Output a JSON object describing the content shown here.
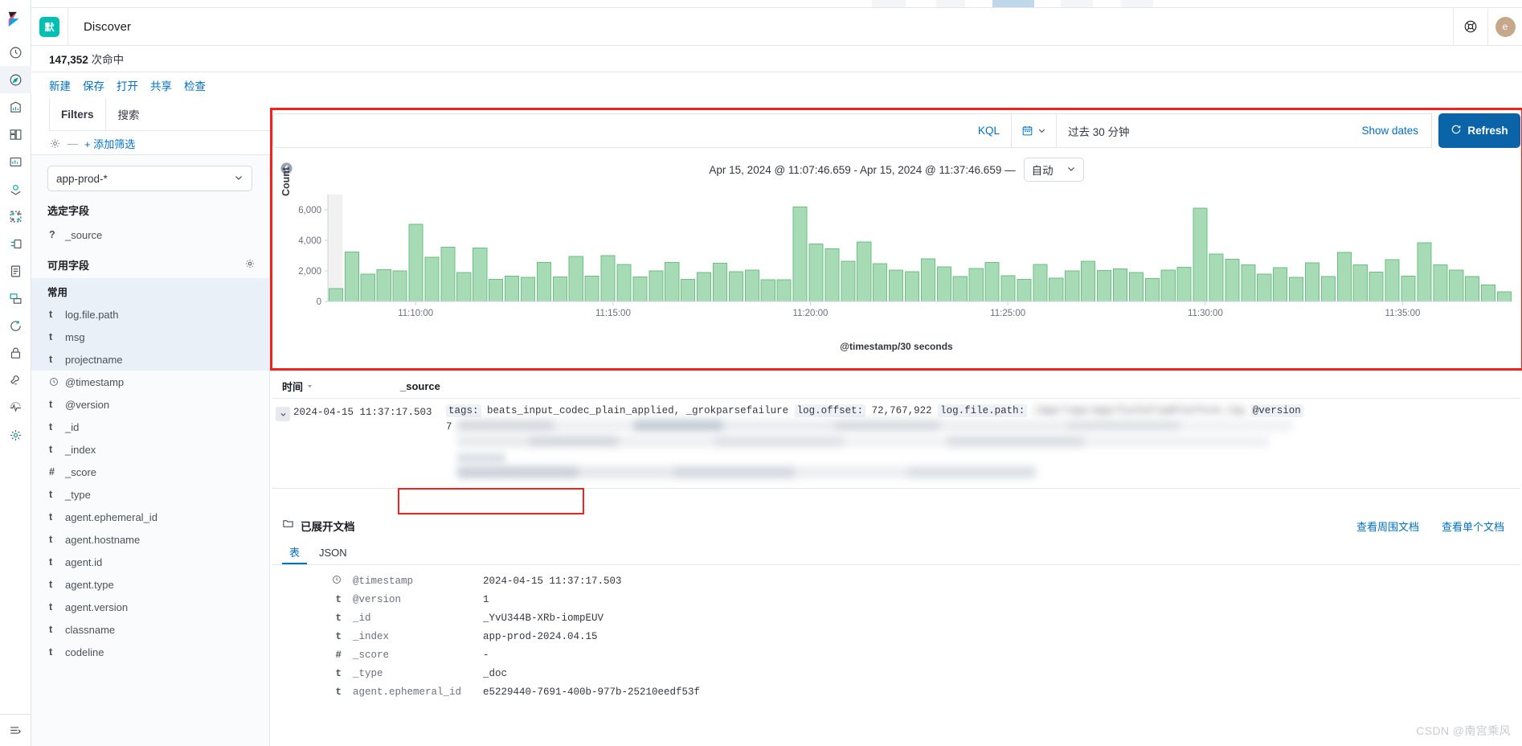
{
  "header": {
    "space_badge": "默",
    "app_title": "Discover",
    "help_icon": "help-circle-icon",
    "avatar_initial": "e"
  },
  "hits": {
    "count": "147,352",
    "suffix": "次命中"
  },
  "menu": {
    "items": [
      "新建",
      "保存",
      "打开",
      "共享",
      "检查"
    ]
  },
  "filterbar": {
    "tabs": [
      "Filters",
      "搜索"
    ],
    "gear_icon": "gear-icon",
    "dash": "—",
    "add_filter": "+ 添加筛选"
  },
  "querybar": {
    "language": "KQL",
    "calendar_icon": "calendar-icon",
    "time_range": "过去 30 分钟",
    "show_dates": "Show dates",
    "refresh_label": "Refresh",
    "refresh_icon": "refresh-icon",
    "refresh_color": "#0b64a8",
    "highlight_color": "#f0241e"
  },
  "sidebar": {
    "index_pattern": "app-prod-*",
    "selected_fields_title": "选定字段",
    "selected_fields": [
      {
        "type": "?",
        "name": "_source"
      }
    ],
    "available_fields_title": "可用字段",
    "gear_icon": "gear-icon",
    "popular_title": "常用",
    "popular_fields": [
      {
        "type": "t",
        "name": "log.file.path"
      },
      {
        "type": "t",
        "name": "msg"
      },
      {
        "type": "t",
        "name": "projectname"
      }
    ],
    "fields": [
      {
        "type": "clock",
        "name": "@timestamp"
      },
      {
        "type": "t",
        "name": "@version"
      },
      {
        "type": "t",
        "name": "_id"
      },
      {
        "type": "t",
        "name": "_index"
      },
      {
        "type": "#",
        "name": "_score"
      },
      {
        "type": "t",
        "name": "_type"
      },
      {
        "type": "t",
        "name": "agent.ephemeral_id"
      },
      {
        "type": "t",
        "name": "agent.hostname"
      },
      {
        "type": "t",
        "name": "agent.id"
      },
      {
        "type": "t",
        "name": "agent.type"
      },
      {
        "type": "t",
        "name": "agent.version"
      },
      {
        "type": "t",
        "name": "classname"
      },
      {
        "type": "t",
        "name": "codeline"
      }
    ]
  },
  "rail": {
    "items": [
      "recently-viewed-icon",
      "discover-icon",
      "visualize-icon",
      "dashboard-icon",
      "canvas-icon",
      "maps-icon",
      "machine-learning-icon",
      "graph-icon",
      "logs-icon",
      "metrics-icon",
      "uptime-icon",
      "security-icon",
      "dev-tools-icon",
      "monitoring-icon",
      "management-icon"
    ],
    "collapse_icon": "collapse-menu-icon"
  },
  "chart": {
    "collapse_icon": "chevron-left-circle-icon",
    "time_range_title": "Apr 15, 2024 @ 11:07:46.659 - Apr 15, 2024 @ 11:37:46.659 —",
    "interval_label": "自动",
    "chevron_icon": "chevron-down-icon"
  },
  "chart_data": {
    "type": "bar",
    "title": "Apr 15, 2024 @ 11:07:46.659 - Apr 15, 2024 @ 11:37:46.659 —",
    "xlabel": "@timestamp/30 seconds",
    "ylabel": "Count",
    "ylim": [
      0,
      7000
    ],
    "yticks": [
      0,
      2000,
      4000,
      6000
    ],
    "ytick_labels": [
      "0",
      "2,000",
      "4,000",
      "6,000"
    ],
    "xtick_labels": [
      "11:10:00",
      "11:15:00",
      "11:20:00",
      "11:25:00",
      "11:30:00",
      "11:35:00"
    ],
    "grid": false,
    "legend": false,
    "bar_color": "#a7dbb5",
    "bar_stroke": "#6cbf84",
    "partial_bucket_color": "#e6e6e6",
    "values": [
      830,
      3250,
      1780,
      2080,
      1990,
      5050,
      2890,
      3560,
      1890,
      3490,
      1440,
      1660,
      1580,
      2540,
      1600,
      2950,
      1650,
      2990,
      2430,
      1610,
      2010,
      2540,
      1460,
      1890,
      2490,
      1940,
      2060,
      1420,
      1430,
      6180,
      3770,
      3450,
      2630,
      3890,
      2470,
      2060,
      1950,
      2780,
      2270,
      1620,
      2160,
      2540,
      1690,
      1450,
      2430,
      1520,
      2000,
      2630,
      2020,
      2130,
      1890,
      1500,
      2050,
      2240,
      6100,
      3100,
      2760,
      2390,
      1790,
      2200,
      1580,
      2520,
      1620,
      3200,
      2390,
      1910,
      2740,
      1650,
      3840,
      2390,
      2050,
      1640,
      1080,
      620
    ]
  },
  "doc_table": {
    "columns": [
      "时间",
      "_source"
    ],
    "sort_icon": "sort-down-icon",
    "row": {
      "time": "2024-04-15 11:37:17.503",
      "expand_icon": "chevron-down-icon",
      "source_parts": [
        {
          "key": "tags:",
          "value": "beats_input_codec_plain_applied, _grokparsefailure"
        },
        {
          "key": "log.offset:",
          "value": "72,767,922"
        },
        {
          "key": "log.file.path:",
          "value": "/app/logs/app/fuifuFlowPlatform.log"
        },
        {
          "key": "@version",
          "value": ""
        }
      ]
    }
  },
  "expanded_doc": {
    "folder_icon": "folder-open-icon",
    "title": "已展开文档",
    "links": [
      "查看周围文档",
      "查看单个文档"
    ],
    "tabs": [
      "表",
      "JSON"
    ],
    "active_tab": "表",
    "fields": [
      {
        "type": "clock",
        "name": "@timestamp",
        "value": "2024-04-15 11:37:17.503",
        "highlight": true
      },
      {
        "type": "t",
        "name": "@version",
        "value": "1",
        "highlight": false
      },
      {
        "type": "t",
        "name": "_id",
        "value": "_YvU344B-XRb-iompEUV",
        "highlight": false
      },
      {
        "type": "t",
        "name": "_index",
        "value": "app-prod-2024.04.15",
        "highlight": false
      },
      {
        "type": "#",
        "name": "_score",
        "value": "-",
        "highlight": false
      },
      {
        "type": "t",
        "name": "_type",
        "value": "_doc",
        "highlight": false
      },
      {
        "type": "t",
        "name": "agent.ephemeral_id",
        "value": "e5229440-7691-400b-977b-25210eedf53f",
        "highlight": false
      }
    ]
  },
  "watermark": "CSDN @南宫乘风"
}
